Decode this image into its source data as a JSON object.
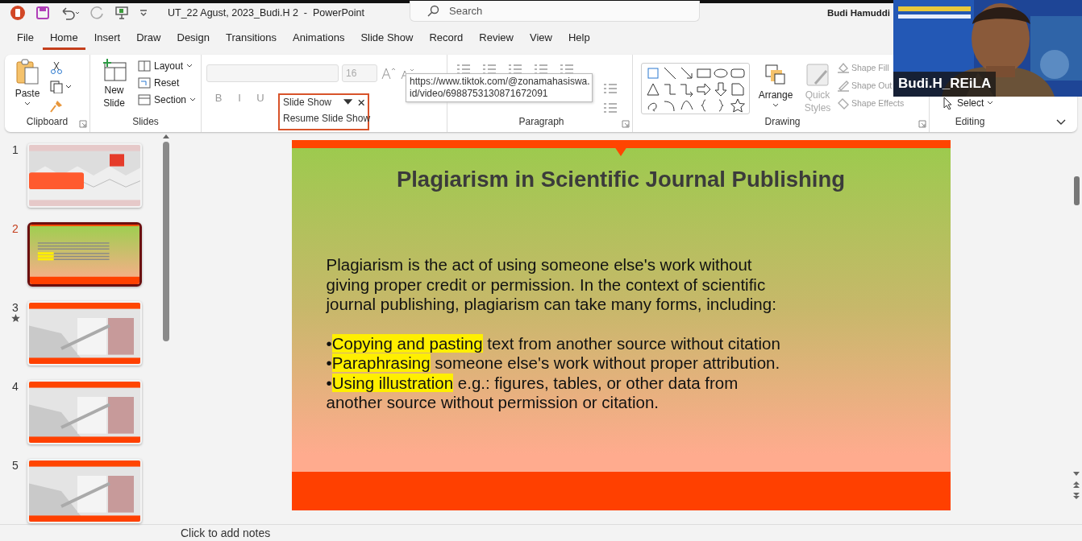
{
  "window": {
    "title": "UT_22 Agust, 2023_Budi.H 2  -  PowerPoint",
    "user": "Budi Hamuddi"
  },
  "search": {
    "placeholder": "Search"
  },
  "tabs": [
    {
      "label": "File",
      "selected": false
    },
    {
      "label": "Home",
      "selected": true
    },
    {
      "label": "Insert",
      "selected": false
    },
    {
      "label": "Draw",
      "selected": false
    },
    {
      "label": "Design",
      "selected": false
    },
    {
      "label": "Transitions",
      "selected": false
    },
    {
      "label": "Animations",
      "selected": false
    },
    {
      "label": "Slide Show",
      "selected": false
    },
    {
      "label": "Record",
      "selected": false
    },
    {
      "label": "Review",
      "selected": false
    },
    {
      "label": "View",
      "selected": false
    },
    {
      "label": "Help",
      "selected": false
    }
  ],
  "ribbon": {
    "clipboard": {
      "label": "Clipboard",
      "paste": "Paste"
    },
    "slides": {
      "label": "Slides",
      "new_slide": "New Slide",
      "items": [
        "Layout",
        "Reset",
        "Section"
      ]
    },
    "font": {
      "size": "16",
      "format_buttons": [
        "B",
        "I",
        "U"
      ]
    },
    "paragraph": {
      "label": "Paragraph"
    },
    "drawing": {
      "label": "Drawing",
      "arrange": "Arrange",
      "quick_styles": "Quick Styles",
      "shape_commands": [
        "Shape Fill",
        "Shape Out",
        "Shape Effects"
      ]
    },
    "editing": {
      "label": "Editing",
      "select": "Select"
    }
  },
  "slide_show_popup": {
    "title": "Slide Show",
    "action": "Resume Slide Show"
  },
  "tooltip": {
    "lines": [
      "https://www.tiktok.com/@zonamahasiswa.",
      "id/video/6988753130871672091"
    ]
  },
  "thumbnails": [
    {
      "number": "1",
      "kind": "cover",
      "selected": false,
      "animated": false
    },
    {
      "number": "2",
      "kind": "gradient",
      "selected": true,
      "animated": false
    },
    {
      "number": "3",
      "selected": false,
      "animated": true
    },
    {
      "number": "4",
      "selected": false,
      "animated": false
    },
    {
      "number": "5",
      "selected": false,
      "animated": false
    }
  ],
  "slide": {
    "title": "Plagiarism in Scientific Journal Publishing",
    "intro": "Plagiarism is the act of using someone else's work without giving proper credit or permission. In the context of scientific journal publishing, plagiarism can take many forms, including:",
    "bullets": [
      {
        "marker": "•",
        "highlight": "Copying and pasting",
        "text": " text from another source without citation"
      },
      {
        "marker": "•",
        "highlight": "Paraphrasing",
        "text": " someone else's work without proper attribution."
      },
      {
        "marker": "•",
        "highlight": "Using illustration",
        "text": " e.g.: figures, tables, or other data from another source without permission or citation."
      }
    ]
  },
  "notes": {
    "placeholder": "Click to add notes"
  },
  "video": {
    "name": "Budi.H_REiLA"
  }
}
